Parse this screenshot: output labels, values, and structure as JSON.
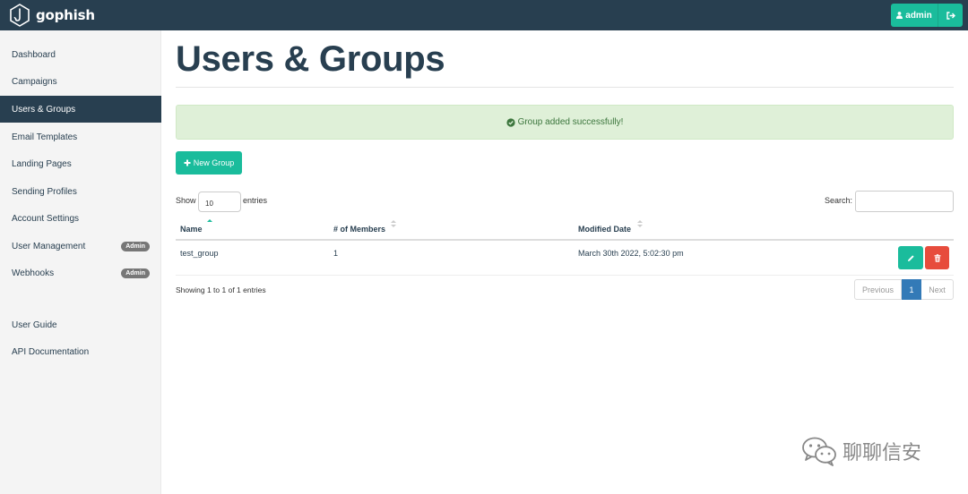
{
  "app": {
    "brand": "gophish",
    "user_label": "admin"
  },
  "sidebar": {
    "items": [
      {
        "label": "Dashboard"
      },
      {
        "label": "Campaigns"
      },
      {
        "label": "Users & Groups",
        "active": true
      },
      {
        "label": "Email Templates"
      },
      {
        "label": "Landing Pages"
      },
      {
        "label": "Sending Profiles"
      },
      {
        "label": "Account Settings"
      },
      {
        "label": "User Management",
        "badge": "Admin"
      },
      {
        "label": "Webhooks",
        "badge": "Admin"
      }
    ],
    "footer_items": [
      {
        "label": "User Guide"
      },
      {
        "label": "API Documentation"
      }
    ]
  },
  "main": {
    "title": "Users & Groups",
    "alert": "Group added successfully!",
    "new_group_label": "New Group",
    "table_controls": {
      "show_label": "Show",
      "page_length": "10",
      "entries_label": "entries",
      "search_label": "Search:",
      "search_value": ""
    },
    "table": {
      "columns": [
        "Name",
        "# of Members",
        "Modified Date"
      ],
      "rows": [
        {
          "name": "test_group",
          "members": "1",
          "modified": "March 30th 2022, 5:02:30 pm"
        }
      ]
    },
    "info": "Showing 1 to 1 of 1 entries",
    "pagination": {
      "previous": "Previous",
      "current": "1",
      "next": "Next"
    }
  },
  "watermark": {
    "text": "聊聊信安"
  },
  "colors": {
    "navbar": "#283f50",
    "accent": "#1abc9c",
    "danger": "#e74c3c",
    "success_bg": "#dff0d8",
    "success_text": "#3c763d",
    "page_active": "#337ab7"
  }
}
